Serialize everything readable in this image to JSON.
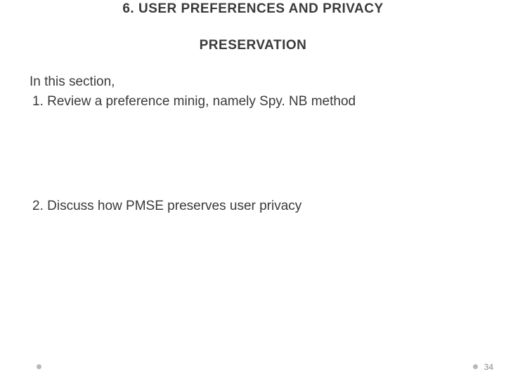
{
  "title": {
    "line1": "6. USER PREFERENCES AND PRIVACY",
    "line2": "PRESERVATION"
  },
  "content": {
    "intro": "In this section,",
    "items": [
      "1.  Review a preference minig, namely Spy. NB method",
      "2.  Discuss how PMSE preserves user privacy"
    ]
  },
  "footer": {
    "page_number": "34"
  }
}
